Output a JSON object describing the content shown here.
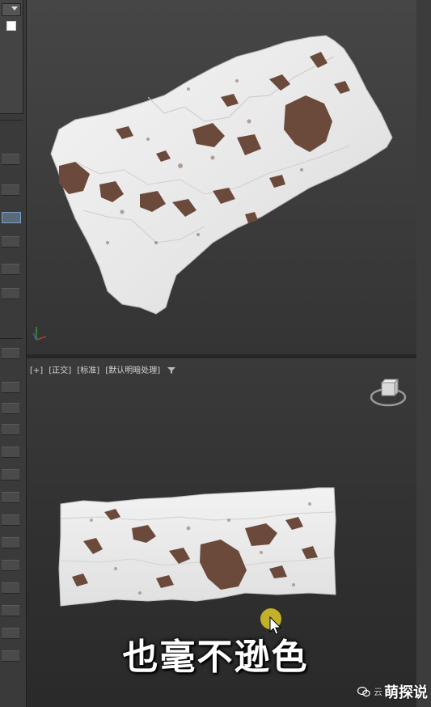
{
  "bottom_viewport": {
    "label_plus": "[+]",
    "label_view": "[正交]",
    "label_mode": "[标准]",
    "label_shading": "[默认明暗处理]"
  },
  "subtitle": "也毫不逊色",
  "watermark": {
    "prefix": "云",
    "brand": "萌探说"
  },
  "icons": {
    "filter": "filter-icon",
    "view_cube": "view-cube-icon",
    "axis": "axis-gizmo-icon",
    "cursor": "mouse-cursor-icon",
    "wechat": "wechat-icon"
  },
  "colors": {
    "mesh_snow": "#ececec",
    "mesh_rock": "#6b4a3c",
    "viewport_bg": "#3a3a3a",
    "cursor_halo": "#dcc828"
  }
}
